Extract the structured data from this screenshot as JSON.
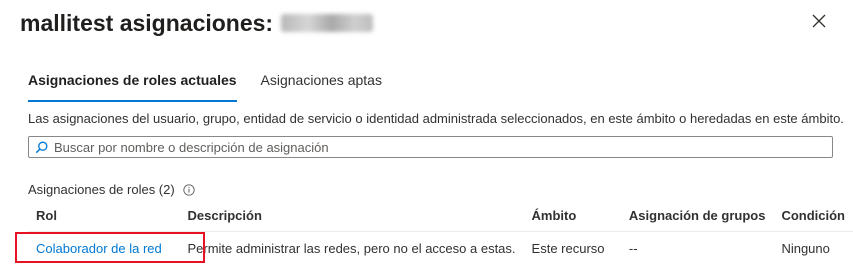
{
  "header": {
    "title": "mallitest asignaciones:",
    "close_label": "Cerrar"
  },
  "tabs": [
    {
      "label": "Asignaciones de roles actuales",
      "active": true
    },
    {
      "label": "Asignaciones aptas",
      "active": false
    }
  ],
  "description": "Las asignaciones del usuario, grupo, entidad de servicio o identidad administrada seleccionados, en este ámbito o heredadas en este ámbito.",
  "search": {
    "placeholder": "Buscar por nombre o descripción de asignación",
    "value": "",
    "icon": "search-icon"
  },
  "section": {
    "label": "Asignaciones de roles (2)",
    "icon": "info-icon"
  },
  "table": {
    "columns": [
      "Rol",
      "Descripción",
      "Ámbito",
      "Asignación de grupos",
      "Condición"
    ],
    "rows": [
      {
        "role": "Colaborador de la red",
        "description": "Permite administrar las redes, pero no el acceso a estas.",
        "scope": "Este recurso",
        "group_assignment": "--",
        "condition": "Ninguno"
      }
    ]
  },
  "colors": {
    "accent": "#0078d4",
    "highlight": "#e81123",
    "text": "#323130"
  }
}
